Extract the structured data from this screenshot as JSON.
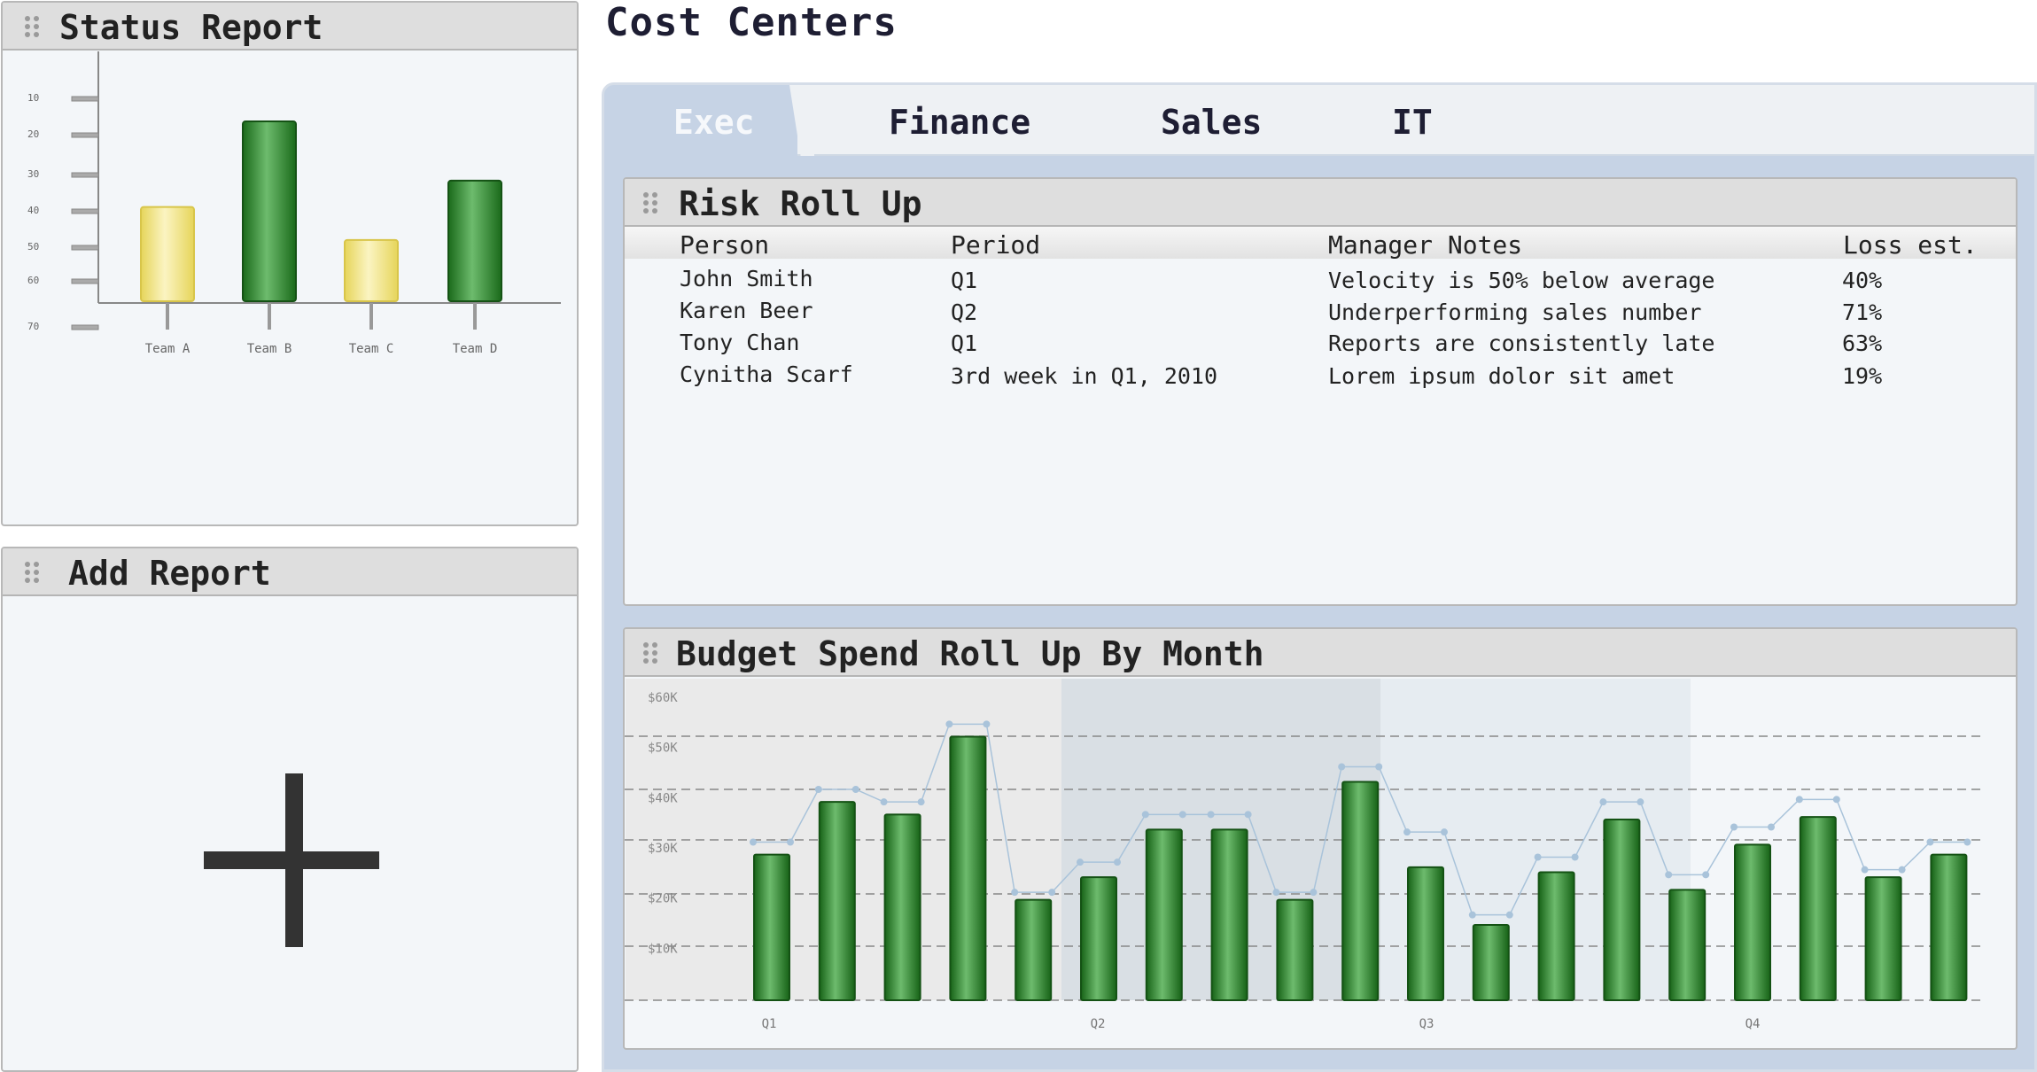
{
  "page": {
    "title": "Cost Centers"
  },
  "status_report": {
    "title": "Status Report",
    "chart_data": {
      "type": "bar",
      "categories": [
        "Team A",
        "Team B",
        "Team C",
        "Team D"
      ],
      "values": [
        43,
        17,
        53,
        35
      ],
      "ytick_labels": [
        "10",
        "20",
        "30",
        "40",
        "50",
        "60",
        "70"
      ],
      "colors": [
        "#e8d85a",
        "#1f7a1f",
        "#e8d85a",
        "#1f7a1f"
      ]
    }
  },
  "add_report": {
    "title": "Add Report"
  },
  "tabs": [
    {
      "label": "Exec",
      "active": true
    },
    {
      "label": "Finance",
      "active": false
    },
    {
      "label": "Sales",
      "active": false
    },
    {
      "label": "IT",
      "active": false
    }
  ],
  "risk_rollup": {
    "title": "Risk Roll Up",
    "columns": [
      "Person",
      "Period",
      "Manager Notes",
      "Loss est."
    ],
    "rows": [
      [
        "John Smith",
        "Q1",
        "Velocity is 50% below average",
        "40%"
      ],
      [
        "Karen Beer",
        "Q2",
        "Underperforming sales number",
        "71%"
      ],
      [
        "Tony Chan",
        "Q1",
        "Reports are consistently late",
        "63%"
      ],
      [
        "Cynitha Scarf",
        "3rd week in Q1, 2010",
        "Lorem ipsum dolor sit amet",
        "19%"
      ]
    ]
  },
  "budget_rollup": {
    "title": "Budget Spend Roll Up By Month",
    "chart_data": {
      "type": "bar",
      "ytick_labels": [
        "$60K",
        "$50K",
        "$40K",
        "$30K",
        "$20K",
        "$10K"
      ],
      "ylim": [
        0,
        60000
      ],
      "quarter_labels": [
        "Q1",
        "Q2",
        "Q3",
        "Q4"
      ],
      "series": [
        {
          "values": [
            29000,
            39500,
            37000,
            52500,
            20000,
            24500,
            34000,
            34000,
            20000,
            43500,
            26500,
            15000,
            25500,
            36000,
            22000,
            31000,
            36500,
            24500,
            29000
          ]
        },
        {
          "values": [
            31500,
            42000,
            39500,
            55000,
            21500,
            27500,
            37000,
            37000,
            21500,
            46500,
            33500,
            17000,
            28500,
            39500,
            25000,
            34500,
            40000,
            26000,
            31500
          ]
        }
      ],
      "bar_color": "#1f7a1f",
      "line_color": "#a9c3da"
    }
  }
}
